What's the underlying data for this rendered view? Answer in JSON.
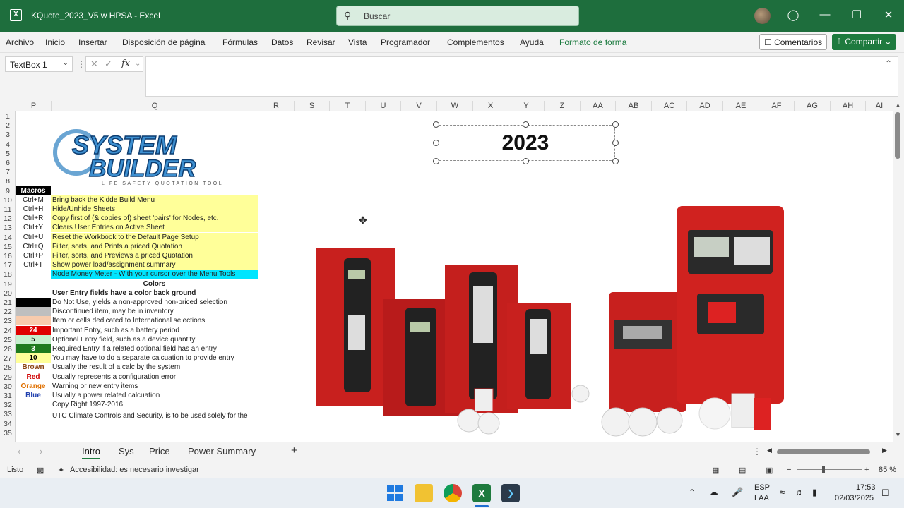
{
  "titlebar": {
    "title": "KQuote_2023_V5 w HPSA  -  Excel",
    "search_placeholder": "Buscar"
  },
  "menu": {
    "items": [
      "Archivo",
      "Inicio",
      "Insertar",
      "Disposición de página",
      "Fórmulas",
      "Datos",
      "Revisar",
      "Vista",
      "Programador",
      "Complementos",
      "Ayuda",
      "Formato de forma"
    ],
    "comments": "Comentarios",
    "share": "Compartir"
  },
  "formulabar": {
    "namebox": "TextBox 1",
    "fx": "fx"
  },
  "columns": [
    "P",
    "Q",
    "R",
    "S",
    "T",
    "U",
    "V",
    "W",
    "X",
    "Y",
    "Z",
    "AA",
    "AB",
    "AC",
    "AD",
    "AE",
    "AF",
    "AG",
    "AH",
    "AI"
  ],
  "rows": [
    "1",
    "2",
    "3",
    "4",
    "5",
    "6",
    "7",
    "8",
    "9",
    "10",
    "11",
    "12",
    "13",
    "14",
    "15",
    "16",
    "17",
    "18",
    "19",
    "20",
    "21",
    "22",
    "23",
    "24",
    "25",
    "26",
    "27",
    "28",
    "29",
    "30",
    "31",
    "32",
    "33",
    "34",
    "35"
  ],
  "logo": {
    "line1": "SYSTEM",
    "line2": "BUILDER",
    "tagline": "LIFE SAFETY QUOTATION TOOL"
  },
  "sheet": {
    "macros_header": "Macros",
    "macros": [
      {
        "key": "Ctrl+M",
        "desc": "Bring back the Kidde Build Menu"
      },
      {
        "key": "Ctrl+H",
        "desc": "Hide/Unhide Sheets"
      },
      {
        "key": "Ctrl+R",
        "desc": "Copy first of (& copies of) sheet 'pairs' for Nodes, etc."
      },
      {
        "key": "Ctrl+Y",
        "desc": "Clears User Entries on Active Sheet"
      },
      {
        "key": "Ctrl+U",
        "desc": "Reset the Workbook to the Default Page Setup"
      },
      {
        "key": "Ctrl+Q",
        "desc": "Filter, sorts, and Prints a priced Quotation"
      },
      {
        "key": "Ctrl+P",
        "desc": "Filter, sorts, and Previews a priced Quotation"
      },
      {
        "key": "Ctrl+T",
        "desc": "Show power load/assignment summary"
      }
    ],
    "node_money": "Node Money Meter - With your cursor over the Menu Tools",
    "colors_header": "Colors",
    "user_entry_header": "User Entry fields have a color back ground",
    "legend": [
      {
        "swatch": "",
        "bg": "#000000",
        "fg": "#ffffff",
        "desc": "Do Not Use, yields a non-approved non-priced selection"
      },
      {
        "swatch": "",
        "bg": "#bfbfbf",
        "fg": "#000000",
        "desc": "Discontinued item, may be in inventory"
      },
      {
        "swatch": "",
        "bg": "#f8cbad",
        "fg": "#000000",
        "desc": "Item or cells dedicated to International selections"
      },
      {
        "swatch": "24",
        "bg": "#e00000",
        "fg": "#ffffff",
        "desc": "Important Entry, such as a battery period"
      },
      {
        "swatch": "5",
        "bg": "#c6efce",
        "fg": "#000000",
        "desc": "Optional Entry field, such as a device quantity"
      },
      {
        "swatch": "3",
        "bg": "#1e7a1e",
        "fg": "#ffffff",
        "desc": "Required Entry if a related optional field has an entry"
      },
      {
        "swatch": "10",
        "bg": "#ffff99",
        "fg": "#000000",
        "desc": "You may have to do a separate calcuation to provide entry"
      },
      {
        "swatch": "Brown",
        "bg": "#ffffff",
        "fg": "#8b4513",
        "desc": "Usually the result of a calc by the system"
      },
      {
        "swatch": "Red",
        "bg": "#ffffff",
        "fg": "#d00000",
        "desc": "Usually represents a configuration error"
      },
      {
        "swatch": "Orange",
        "bg": "#ffffff",
        "fg": "#e07000",
        "desc": "Warning or new entry items"
      },
      {
        "swatch": "Blue",
        "bg": "#ffffff",
        "fg": "#1f3fae",
        "desc": "Usually a power related calcuation"
      }
    ],
    "copyright": "Copy Right 1997-2016",
    "utc_line": "UTC Climate Controls and Security, is to be used solely for the"
  },
  "textbox": {
    "value": "2023"
  },
  "tabs": {
    "items": [
      "Intro",
      "Sys",
      "Price",
      "Power Summary"
    ],
    "active": "Intro",
    "add": "+"
  },
  "status": {
    "ready": "Listo",
    "accessibility": "Accesibilidad: es necesario investigar",
    "zoom": "85 %"
  },
  "taskbar": {
    "lang1": "ESP",
    "lang2": "LAA",
    "time": "17:53",
    "date": "02/03/2025"
  },
  "colors": {
    "excel_green": "#1e6e3d",
    "accent_green": "#1e7a3e",
    "macro_yellow": "#ffff99",
    "node_cyan": "#00e5ff"
  }
}
